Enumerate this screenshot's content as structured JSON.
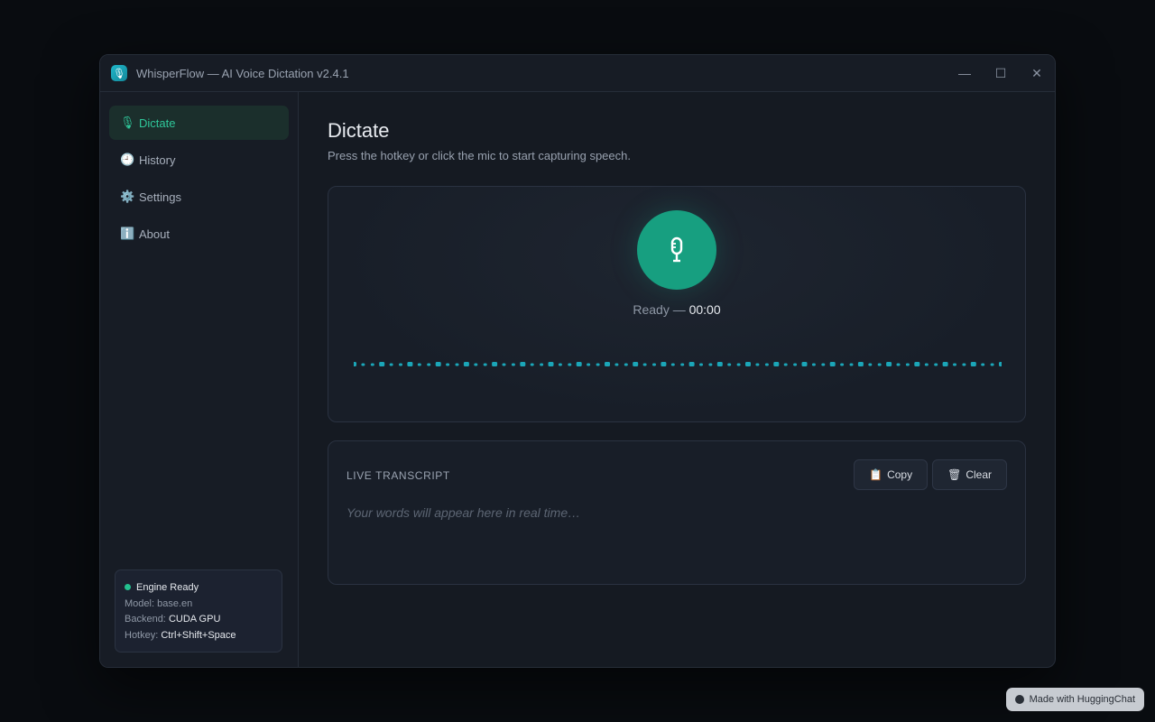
{
  "window": {
    "title": "WhisperFlow — AI Voice Dictation v2.4.1",
    "app_icon": "microphone-icon",
    "controls": {
      "minimize": "—",
      "maximize": "☐",
      "close": "✕"
    }
  },
  "sidebar": {
    "items": [
      {
        "icon": "🎙",
        "icon_name": "microphone-icon",
        "label": "Dictate",
        "active": true
      },
      {
        "icon": "🕘",
        "icon_name": "clock-icon",
        "label": "History"
      },
      {
        "icon": "⚙️",
        "icon_name": "gear-icon",
        "label": "Settings"
      },
      {
        "icon": "ℹ️",
        "icon_name": "info-icon",
        "label": "About"
      }
    ],
    "status": {
      "title": "Engine Ready",
      "model_label": "Model:",
      "model": "base.en",
      "backend_label": "Backend:",
      "backend": "CUDA GPU",
      "hotkey_label": "Hotkey:",
      "hotkey": "Ctrl+Shift+Space"
    }
  },
  "main": {
    "title": "Dictate",
    "subtitle": "Press the hotkey or click the mic to start capturing speech.",
    "recorder": {
      "state": "Ready",
      "separator": " — ",
      "time": "00:00",
      "accent": "#179f80",
      "wave_color": "#1ba6b8"
    },
    "transcript": {
      "label": "LIVE TRANSCRIPT",
      "copy_icon": "📋",
      "copy_label": "Copy",
      "clear_icon": "🗑",
      "clear_label": "Clear",
      "placeholder": "Your words will appear here in real time…"
    }
  },
  "badge": {
    "label": "Made with HuggingChat",
    "icon": "huggingchat-icon"
  }
}
